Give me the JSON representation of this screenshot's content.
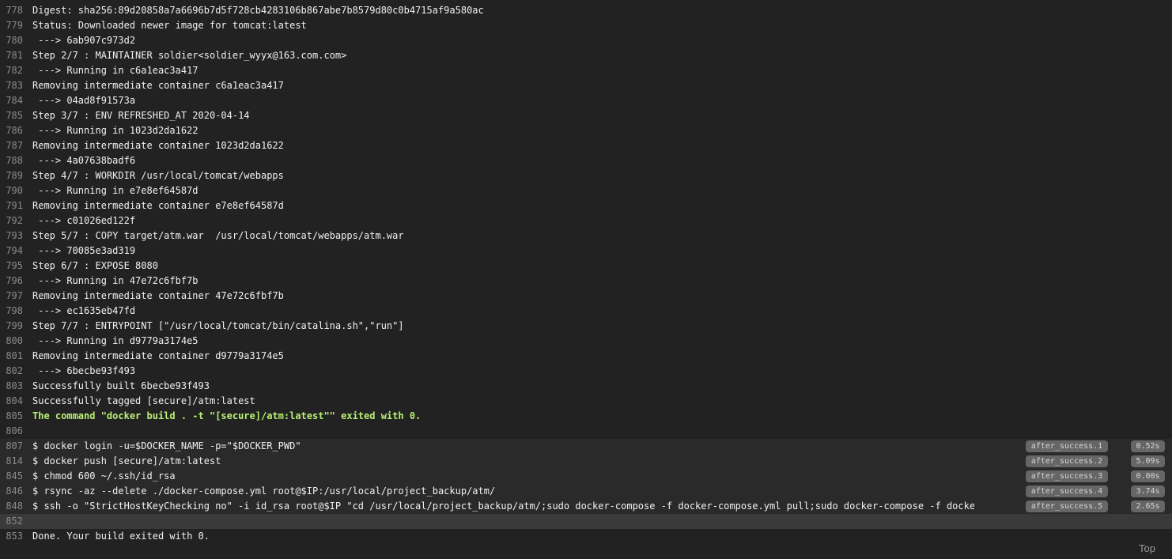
{
  "lines": [
    {
      "num": "778",
      "text": "Digest: sha256:89d20858a7a6696b7d5f728cb4283106b867abe7b8579d80c0b4715af9a580ac"
    },
    {
      "num": "779",
      "text": "Status: Downloaded newer image for tomcat:latest"
    },
    {
      "num": "780",
      "text": " ---> 6ab907c973d2"
    },
    {
      "num": "781",
      "text": "Step 2/7 : MAINTAINER soldier<soldier_wyyx@163.com.com>"
    },
    {
      "num": "782",
      "text": " ---> Running in c6a1eac3a417"
    },
    {
      "num": "783",
      "text": "Removing intermediate container c6a1eac3a417"
    },
    {
      "num": "784",
      "text": " ---> 04ad8f91573a"
    },
    {
      "num": "785",
      "text": "Step 3/7 : ENV REFRESHED_AT 2020-04-14"
    },
    {
      "num": "786",
      "text": " ---> Running in 1023d2da1622"
    },
    {
      "num": "787",
      "text": "Removing intermediate container 1023d2da1622"
    },
    {
      "num": "788",
      "text": " ---> 4a07638badf6"
    },
    {
      "num": "789",
      "text": "Step 4/7 : WORKDIR /usr/local/tomcat/webapps"
    },
    {
      "num": "790",
      "text": " ---> Running in e7e8ef64587d"
    },
    {
      "num": "791",
      "text": "Removing intermediate container e7e8ef64587d"
    },
    {
      "num": "792",
      "text": " ---> c01026ed122f"
    },
    {
      "num": "793",
      "text": "Step 5/7 : COPY target/atm.war  /usr/local/tomcat/webapps/atm.war"
    },
    {
      "num": "794",
      "text": " ---> 70085e3ad319"
    },
    {
      "num": "795",
      "text": "Step 6/7 : EXPOSE 8080"
    },
    {
      "num": "796",
      "text": " ---> Running in 47e72c6fbf7b"
    },
    {
      "num": "797",
      "text": "Removing intermediate container 47e72c6fbf7b"
    },
    {
      "num": "798",
      "text": " ---> ec1635eb47fd"
    },
    {
      "num": "799",
      "text": "Step 7/7 : ENTRYPOINT [\"/usr/local/tomcat/bin/catalina.sh\",\"run\"]"
    },
    {
      "num": "800",
      "text": " ---> Running in d9779a3174e5"
    },
    {
      "num": "801",
      "text": "Removing intermediate container d9779a3174e5"
    },
    {
      "num": "802",
      "text": " ---> 6becbe93f493"
    },
    {
      "num": "803",
      "text": "Successfully built 6becbe93f493"
    },
    {
      "num": "804",
      "text": "Successfully tagged [secure]/atm:latest"
    },
    {
      "num": "805",
      "text": "The command \"docker build . -t \"[secure]/atm:latest\"\" exited with 0.",
      "style": "success"
    },
    {
      "num": "806",
      "text": ""
    }
  ],
  "folds": [
    {
      "num": "807",
      "text": "$ docker login -u=$DOCKER_NAME -p=\"$DOCKER_PWD\"",
      "tag": "after_success.1",
      "duration": "0.52s"
    },
    {
      "num": "814",
      "text": "$ docker push [secure]/atm:latest",
      "tag": "after_success.2",
      "duration": "5.09s"
    },
    {
      "num": "845",
      "text": "$ chmod 600 ~/.ssh/id_rsa",
      "tag": "after_success.3",
      "duration": "0.00s"
    },
    {
      "num": "846",
      "text": "$ rsync -az --delete ./docker-compose.yml root@$IP:/usr/local/project_backup/atm/",
      "tag": "after_success.4",
      "duration": "3.74s"
    },
    {
      "num": "848",
      "text": "$ ssh -o \"StrictHostKeyChecking no\" -i id_rsa root@$IP \"cd /usr/local/project_backup/atm/;sudo docker-compose -f docker-compose.yml pull;sudo docker-compose -f docker-",
      "tag": "after_success.5",
      "duration": "2.65s"
    }
  ],
  "tail": [
    {
      "num": "852",
      "text": "",
      "highlight": true
    },
    {
      "num": "853",
      "text": "Done. Your build exited with 0."
    }
  ],
  "top_link": "Top",
  "colors": {
    "background": "#222222",
    "line_number": "#8a8a8a",
    "text": "#f1f1f1",
    "success": "#b9ef75",
    "fold_background": "#2a2a2a",
    "tag_background": "#666666"
  }
}
